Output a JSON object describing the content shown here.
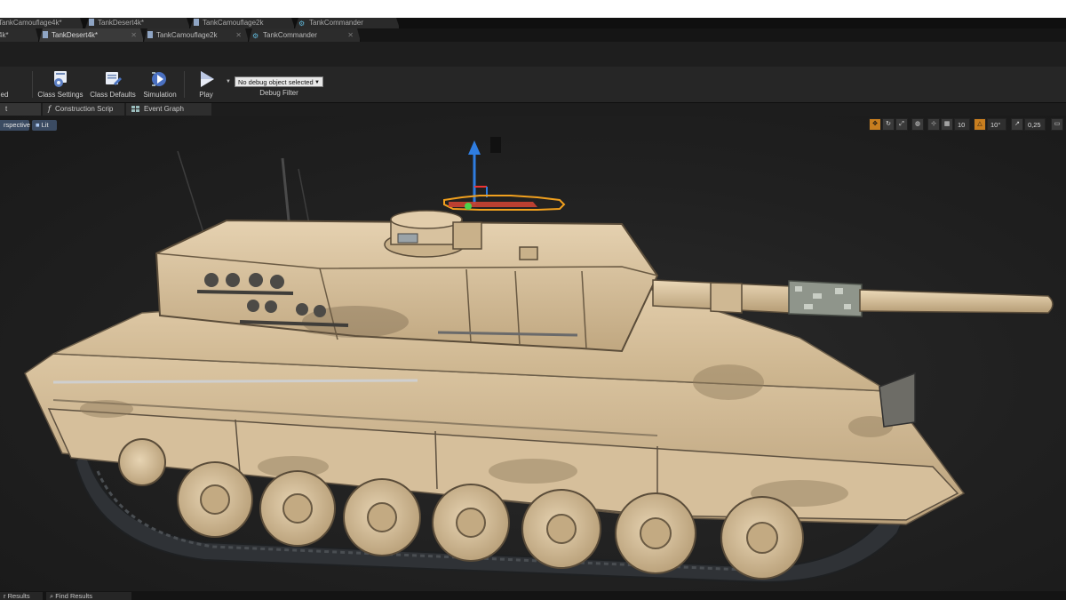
{
  "tabs_back": [
    {
      "label": "TankCamouflage4k*"
    },
    {
      "label": "TankDesert4k*"
    },
    {
      "label": "TankCamouflage2k"
    },
    {
      "label": "TankCommander"
    }
  ],
  "tabs_front": [
    {
      "label": "4k*"
    },
    {
      "label": "TankDesert4k*"
    },
    {
      "label": "TankCamouflage2k"
    },
    {
      "label": "TankCommander"
    }
  ],
  "toolbar": {
    "first_label": "ed",
    "class_settings": "Class Settings",
    "class_defaults": "Class Defaults",
    "simulation": "Simulation",
    "play": "Play",
    "debug_value": "No debug object selected",
    "debug_label": "Debug Filter"
  },
  "graph_tabs": {
    "viewport": "t",
    "construction_script": "Construction Scrip",
    "event_graph": "Event Graph"
  },
  "viewport": {
    "view_mode": "rspective",
    "lighting": "Lit",
    "grid_snap": "10",
    "rotation_snap": "10°",
    "scale_snap": "0,25"
  },
  "bottom_tabs": {
    "compiler_results": "r Results",
    "find_results": "Find Results"
  },
  "colors": {
    "tank_body": "#d9c29f",
    "tank_shadow": "#9a8462",
    "gizmo_blue": "#2f7de0",
    "gizmo_orange": "#f1a01e",
    "accent_orange": "#c87e1f"
  }
}
